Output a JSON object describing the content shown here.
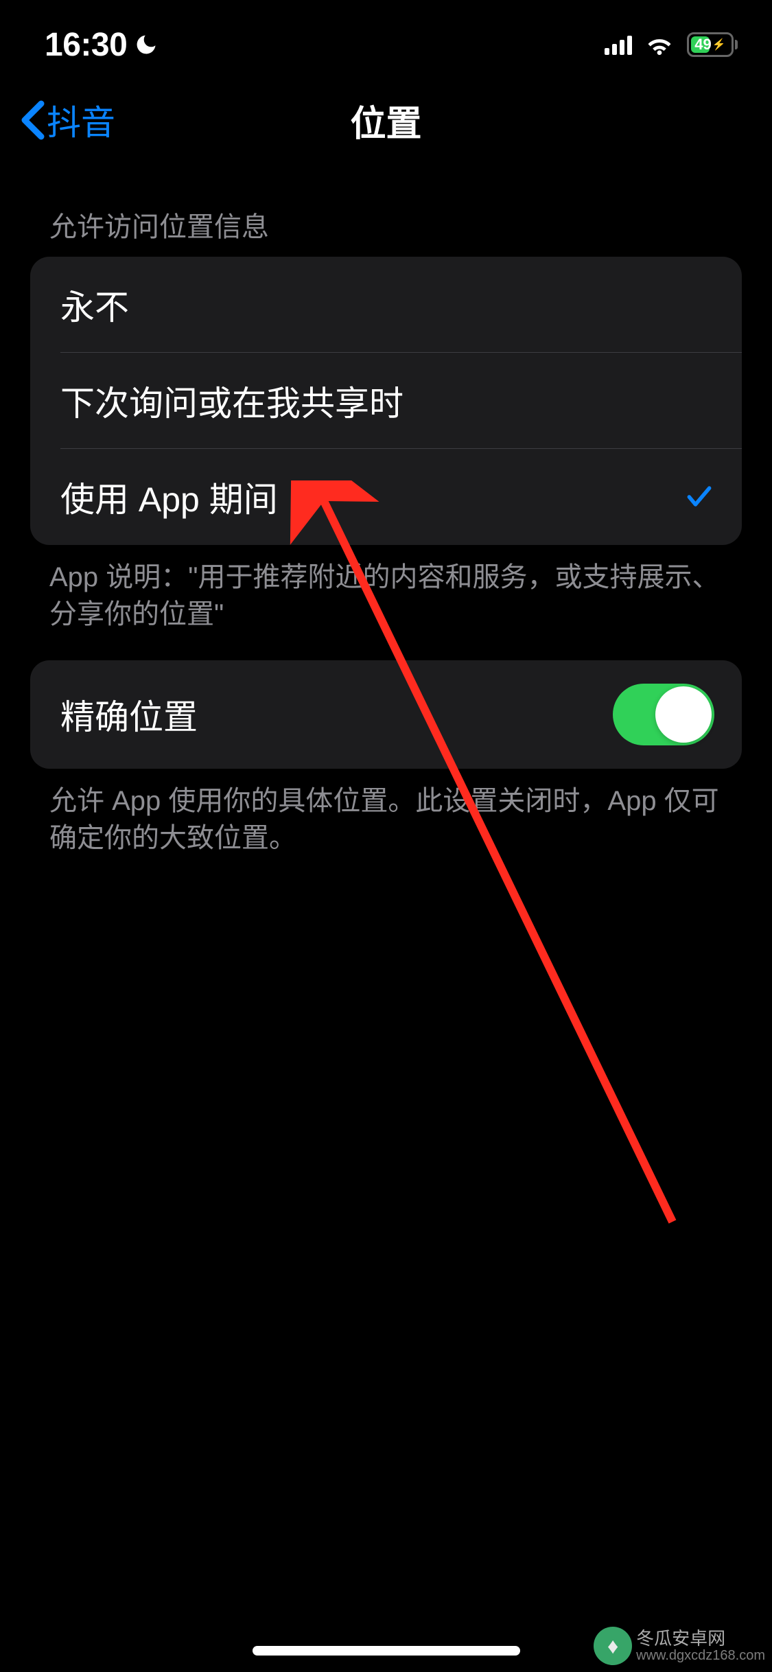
{
  "status_bar": {
    "time": "16:30",
    "battery_percent": "49"
  },
  "nav": {
    "back_label": "抖音",
    "title": "位置"
  },
  "location_section": {
    "header": "允许访问位置信息",
    "options": [
      {
        "label": "永不",
        "selected": false
      },
      {
        "label": "下次询问或在我共享时",
        "selected": false
      },
      {
        "label": "使用 App 期间",
        "selected": true
      }
    ],
    "footer": "App 说明：\"用于推荐附近的内容和服务，或支持展示、分享你的位置\""
  },
  "precise_section": {
    "label": "精确位置",
    "toggle_on": true,
    "footer": "允许 App 使用你的具体位置。此设置关闭时，App 仅可确定你的大致位置。"
  },
  "watermark": {
    "name": "冬瓜安卓网",
    "url": "www.dgxcdz168.com"
  }
}
